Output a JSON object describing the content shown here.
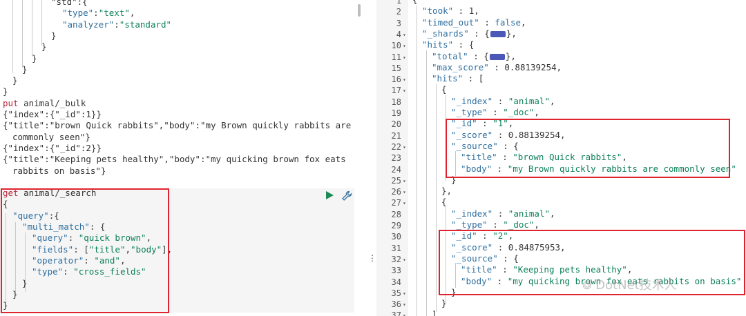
{
  "left_editor": {
    "lines": [
      {
        "indent": 74,
        "parts": [
          {
            "t": "\"std\":{",
            "c": "p"
          }
        ]
      },
      {
        "indent": 90,
        "parts": [
          {
            "t": "\"type\"",
            "c": "k"
          },
          {
            "t": ":",
            "c": "p"
          },
          {
            "t": "\"text\"",
            "c": "s"
          },
          {
            "t": ",",
            "c": "p"
          }
        ]
      },
      {
        "indent": 90,
        "parts": [
          {
            "t": "\"analyzer\"",
            "c": "k"
          },
          {
            "t": ":",
            "c": "p"
          },
          {
            "t": "\"standard\"",
            "c": "s"
          }
        ]
      },
      {
        "indent": 74,
        "parts": [
          {
            "t": "}",
            "c": "p"
          }
        ]
      },
      {
        "indent": 60,
        "parts": [
          {
            "t": "}",
            "c": "p"
          }
        ]
      },
      {
        "indent": 46,
        "parts": [
          {
            "t": "}",
            "c": "p"
          }
        ]
      },
      {
        "indent": 32,
        "parts": [
          {
            "t": "}",
            "c": "p"
          }
        ]
      },
      {
        "indent": 18,
        "parts": [
          {
            "t": "}",
            "c": "p"
          }
        ]
      },
      {
        "indent": 4,
        "parts": [
          {
            "t": "}",
            "c": "p"
          }
        ]
      },
      {
        "indent": 4,
        "parts": [
          {
            "t": "put",
            "c": "kw"
          },
          {
            "t": " animal/_bulk",
            "c": "p"
          }
        ]
      },
      {
        "indent": 4,
        "parts": [
          {
            "t": "{\"index\":{\"_id\":1}}",
            "c": "p"
          }
        ]
      },
      {
        "indent": 4,
        "parts": [
          {
            "t": "{\"title\":\"brown Quick rabbits\",\"body\":\"my Brown quickly rabbits are",
            "c": "p"
          }
        ]
      },
      {
        "indent": 18,
        "parts": [
          {
            "t": "commonly seen\"}",
            "c": "p"
          }
        ]
      },
      {
        "indent": 4,
        "parts": [
          {
            "t": "{\"index\":{\"_id\":2}}",
            "c": "p"
          }
        ]
      },
      {
        "indent": 4,
        "parts": [
          {
            "t": "{\"title\":\"Keeping pets healthy\",\"body\":\"my quicking brown fox eats",
            "c": "p"
          }
        ]
      },
      {
        "indent": 18,
        "parts": [
          {
            "t": "rabbits on basis\"}",
            "c": "p"
          }
        ]
      },
      {
        "indent": 4,
        "parts": [
          {
            "t": "",
            "c": "p"
          }
        ]
      },
      {
        "indent": 4,
        "parts": [
          {
            "t": "get",
            "c": "kw"
          },
          {
            "t": " animal/_search",
            "c": "p"
          }
        ]
      },
      {
        "indent": 4,
        "parts": [
          {
            "t": "{",
            "c": "p"
          }
        ]
      },
      {
        "indent": 18,
        "parts": [
          {
            "t": "\"query\"",
            "c": "k"
          },
          {
            "t": ":{",
            "c": "p"
          }
        ]
      },
      {
        "indent": 32,
        "parts": [
          {
            "t": "\"multi_match\"",
            "c": "k"
          },
          {
            "t": ": {",
            "c": "p"
          }
        ]
      },
      {
        "indent": 46,
        "parts": [
          {
            "t": "\"query\"",
            "c": "k"
          },
          {
            "t": ": ",
            "c": "p"
          },
          {
            "t": "\"quick brown\"",
            "c": "s"
          },
          {
            "t": ",",
            "c": "p"
          }
        ]
      },
      {
        "indent": 46,
        "parts": [
          {
            "t": "\"fields\"",
            "c": "k"
          },
          {
            "t": ": [",
            "c": "p"
          },
          {
            "t": "\"title\"",
            "c": "s"
          },
          {
            "t": ",",
            "c": "p"
          },
          {
            "t": "\"body\"",
            "c": "s"
          },
          {
            "t": "],",
            "c": "p"
          }
        ]
      },
      {
        "indent": 46,
        "parts": [
          {
            "t": "\"operator\"",
            "c": "k"
          },
          {
            "t": ": ",
            "c": "p"
          },
          {
            "t": "\"and\"",
            "c": "s"
          },
          {
            "t": ",",
            "c": "p"
          }
        ]
      },
      {
        "indent": 46,
        "parts": [
          {
            "t": "\"type\"",
            "c": "k"
          },
          {
            "t": ": ",
            "c": "p"
          },
          {
            "t": "\"cross_fields\"",
            "c": "s"
          }
        ]
      },
      {
        "indent": 32,
        "parts": [
          {
            "t": "}",
            "c": "p"
          }
        ]
      },
      {
        "indent": 18,
        "parts": [
          {
            "t": "}",
            "c": "p"
          }
        ]
      },
      {
        "indent": 4,
        "parts": [
          {
            "t": "}",
            "c": "p"
          }
        ]
      }
    ],
    "run_icon": "play-icon",
    "wrench_icon": "wrench-icon"
  },
  "right_panel": {
    "lines": [
      {
        "n": "1",
        "fold": false,
        "indent": 0,
        "parts": [
          {
            "t": "{",
            "c": "p"
          }
        ]
      },
      {
        "n": "2",
        "fold": false,
        "indent": 1,
        "parts": [
          {
            "t": "\"took\"",
            "c": "k"
          },
          {
            "t": " : 1,",
            "c": "p"
          }
        ]
      },
      {
        "n": "3",
        "fold": false,
        "indent": 1,
        "parts": [
          {
            "t": "\"timed_out\"",
            "c": "k"
          },
          {
            "t": " : ",
            "c": "p"
          },
          {
            "t": "false",
            "c": "vb"
          },
          {
            "t": ",",
            "c": "p"
          }
        ]
      },
      {
        "n": "4",
        "fold": true,
        "indent": 1,
        "parts": [
          {
            "t": "\"_shards\"",
            "c": "k"
          },
          {
            "t": " : {",
            "c": "p"
          },
          {
            "t": "COLLAPSED",
            "c": "x"
          },
          {
            "t": "},",
            "c": "p"
          }
        ]
      },
      {
        "n": "10",
        "fold": true,
        "indent": 1,
        "parts": [
          {
            "t": "\"hits\"",
            "c": "k"
          },
          {
            "t": " : {",
            "c": "p"
          }
        ]
      },
      {
        "n": "11",
        "fold": true,
        "indent": 2,
        "parts": [
          {
            "t": "\"total\"",
            "c": "k"
          },
          {
            "t": " : {",
            "c": "p"
          },
          {
            "t": "COLLAPSED",
            "c": "x"
          },
          {
            "t": "},",
            "c": "p"
          }
        ]
      },
      {
        "n": "15",
        "fold": false,
        "indent": 2,
        "parts": [
          {
            "t": "\"max_score\"",
            "c": "k"
          },
          {
            "t": " : 0.88139254,",
            "c": "p"
          }
        ]
      },
      {
        "n": "16",
        "fold": true,
        "indent": 2,
        "parts": [
          {
            "t": "\"hits\"",
            "c": "k"
          },
          {
            "t": " : [",
            "c": "p"
          }
        ]
      },
      {
        "n": "17",
        "fold": true,
        "indent": 3,
        "parts": [
          {
            "t": "{",
            "c": "p"
          }
        ]
      },
      {
        "n": "18",
        "fold": false,
        "indent": 4,
        "parts": [
          {
            "t": "\"_index\"",
            "c": "k"
          },
          {
            "t": " : ",
            "c": "p"
          },
          {
            "t": "\"animal\"",
            "c": "s"
          },
          {
            "t": ",",
            "c": "p"
          }
        ]
      },
      {
        "n": "19",
        "fold": false,
        "indent": 4,
        "parts": [
          {
            "t": "\"_type\"",
            "c": "k"
          },
          {
            "t": " : ",
            "c": "p"
          },
          {
            "t": "\"_doc\"",
            "c": "s"
          },
          {
            "t": ",",
            "c": "p"
          }
        ]
      },
      {
        "n": "20",
        "fold": false,
        "indent": 4,
        "parts": [
          {
            "t": "\"_id\"",
            "c": "k"
          },
          {
            "t": " : ",
            "c": "p"
          },
          {
            "t": "\"1\"",
            "c": "s"
          },
          {
            "t": ",",
            "c": "p"
          }
        ]
      },
      {
        "n": "21",
        "fold": false,
        "indent": 4,
        "parts": [
          {
            "t": "\"_score\"",
            "c": "k"
          },
          {
            "t": " : 0.88139254,",
            "c": "p"
          }
        ]
      },
      {
        "n": "22",
        "fold": true,
        "indent": 4,
        "parts": [
          {
            "t": "\"_source\"",
            "c": "k"
          },
          {
            "t": " : {",
            "c": "p"
          }
        ]
      },
      {
        "n": "23",
        "fold": false,
        "indent": 5,
        "parts": [
          {
            "t": "\"title\"",
            "c": "k"
          },
          {
            "t": " : ",
            "c": "p"
          },
          {
            "t": "\"brown Quick rabbits\"",
            "c": "s"
          },
          {
            "t": ",",
            "c": "p"
          }
        ]
      },
      {
        "n": "24",
        "fold": false,
        "indent": 5,
        "parts": [
          {
            "t": "\"body\"",
            "c": "k"
          },
          {
            "t": " : ",
            "c": "p"
          },
          {
            "t": "\"my Brown quickly rabbits are commonly seen\"",
            "c": "s"
          }
        ]
      },
      {
        "n": "25",
        "fold": true,
        "indent": 4,
        "parts": [
          {
            "t": "}",
            "c": "p"
          }
        ]
      },
      {
        "n": "26",
        "fold": true,
        "indent": 3,
        "parts": [
          {
            "t": "},",
            "c": "p"
          }
        ]
      },
      {
        "n": "27",
        "fold": true,
        "indent": 3,
        "parts": [
          {
            "t": "{",
            "c": "p"
          }
        ]
      },
      {
        "n": "28",
        "fold": false,
        "indent": 4,
        "parts": [
          {
            "t": "\"_index\"",
            "c": "k"
          },
          {
            "t": " : ",
            "c": "p"
          },
          {
            "t": "\"animal\"",
            "c": "s"
          },
          {
            "t": ",",
            "c": "p"
          }
        ]
      },
      {
        "n": "29",
        "fold": false,
        "indent": 4,
        "parts": [
          {
            "t": "\"_type\"",
            "c": "k"
          },
          {
            "t": " : ",
            "c": "p"
          },
          {
            "t": "\"_doc\"",
            "c": "s"
          },
          {
            "t": ",",
            "c": "p"
          }
        ]
      },
      {
        "n": "30",
        "fold": false,
        "indent": 4,
        "parts": [
          {
            "t": "\"_id\"",
            "c": "k"
          },
          {
            "t": " : ",
            "c": "p"
          },
          {
            "t": "\"2\"",
            "c": "s"
          },
          {
            "t": ",",
            "c": "p"
          }
        ]
      },
      {
        "n": "31",
        "fold": false,
        "indent": 4,
        "parts": [
          {
            "t": "\"_score\"",
            "c": "k"
          },
          {
            "t": " : 0.84875953,",
            "c": "p"
          }
        ]
      },
      {
        "n": "32",
        "fold": true,
        "indent": 4,
        "parts": [
          {
            "t": "\"_source\"",
            "c": "k"
          },
          {
            "t": " : {",
            "c": "p"
          }
        ]
      },
      {
        "n": "33",
        "fold": false,
        "indent": 5,
        "parts": [
          {
            "t": "\"title\"",
            "c": "k"
          },
          {
            "t": " : ",
            "c": "p"
          },
          {
            "t": "\"Keeping pets healthy\"",
            "c": "s"
          },
          {
            "t": ",",
            "c": "p"
          }
        ]
      },
      {
        "n": "34",
        "fold": false,
        "indent": 5,
        "parts": [
          {
            "t": "\"body\"",
            "c": "k"
          },
          {
            "t": " : ",
            "c": "p"
          },
          {
            "t": "\"my quicking brown fox eats rabbits on basis\"",
            "c": "s"
          }
        ]
      },
      {
        "n": "35",
        "fold": true,
        "indent": 4,
        "parts": [
          {
            "t": "}",
            "c": "p"
          }
        ]
      },
      {
        "n": "36",
        "fold": true,
        "indent": 3,
        "parts": [
          {
            "t": "}",
            "c": "p"
          }
        ]
      },
      {
        "n": "37",
        "fold": true,
        "indent": 2,
        "parts": [
          {
            "t": "]",
            "c": "p"
          }
        ]
      }
    ]
  },
  "divider": {
    "icon": "vertical-ellipsis-icon"
  },
  "watermark": {
    "text": "DotNet技术人"
  },
  "colors": {
    "highlight": "#e0242f",
    "keyword_get": "#b5233a",
    "collapsed_badge": "#4c58b8"
  }
}
